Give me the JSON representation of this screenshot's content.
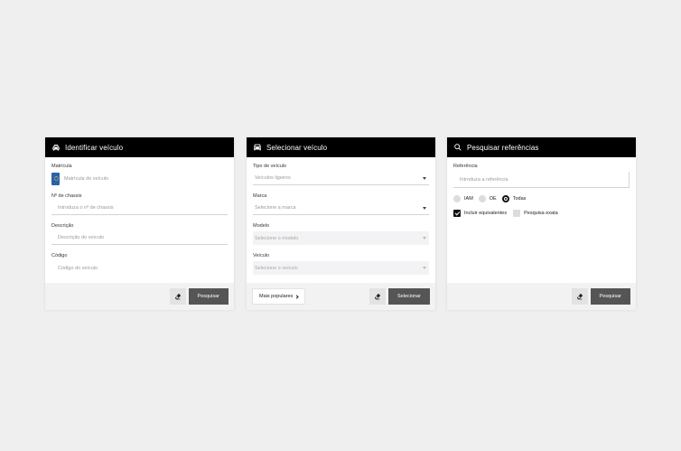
{
  "identify": {
    "title": "Identificar veículo",
    "plate_label": "Matrícula",
    "plate_placeholder": "Matrícula do veículo",
    "vin_label": "Nº de chassis",
    "vin_placeholder": "Introduza o nº de chassis",
    "desc_label": "Descrição",
    "desc_placeholder": "Descrição do veículo",
    "code_label": "Código",
    "code_placeholder": "Código do veículo",
    "search_label": "Pesquisar"
  },
  "select": {
    "title": "Selecionar veículo",
    "type_label": "Tipo de veículo",
    "type_value": "Veículos ligeiros",
    "brand_label": "Marca",
    "brand_value": "Selecione a marca",
    "model_label": "Modelo",
    "model_value": "Selecione o modelo",
    "vehicle_label": "Veículo",
    "vehicle_value": "Selecione o veículo",
    "popular_label": "Mais populares",
    "select_label": "Selecionar"
  },
  "references": {
    "title": "Pesquisar referências",
    "ref_label": "Referência",
    "ref_placeholder": "Introduza a referência",
    "radio_options": [
      "IAM",
      "OE",
      "Todas"
    ],
    "selected_radio": "Todas",
    "include_equivalents": "Incluir equivalentes",
    "exact_search": "Pesquisa exata",
    "search_label": "Pesquisar"
  }
}
